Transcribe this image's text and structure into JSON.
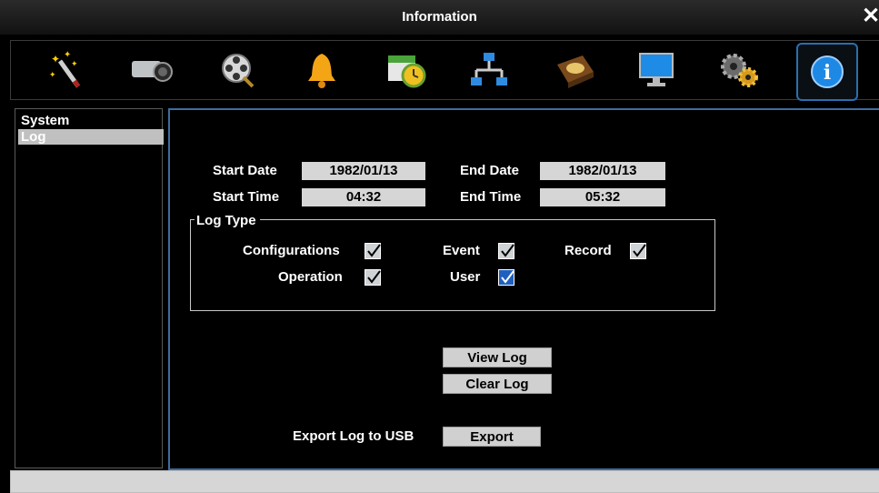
{
  "window": {
    "title": "Information",
    "close_label": "✕"
  },
  "toolbar": {
    "icons": [
      {
        "name": "wizard-icon"
      },
      {
        "name": "camera-icon"
      },
      {
        "name": "film-reel-icon"
      },
      {
        "name": "bell-icon"
      },
      {
        "name": "schedule-clock-icon"
      },
      {
        "name": "network-icon"
      },
      {
        "name": "hard-disk-icon"
      },
      {
        "name": "monitor-icon"
      },
      {
        "name": "gears-icon"
      },
      {
        "name": "info-icon",
        "active": true
      }
    ]
  },
  "sidebar": {
    "items": [
      {
        "label": "System"
      },
      {
        "label": "Log",
        "selected": true
      }
    ]
  },
  "log": {
    "start_date_label": "Start Date",
    "start_date": "1982/01/13",
    "end_date_label": "End Date",
    "end_date": "1982/01/13",
    "start_time_label": "Start Time",
    "start_time": "04:32",
    "end_time_label": "End Time",
    "end_time": "05:32",
    "log_type_label": "Log Type",
    "types": {
      "configurations": {
        "label": "Configurations",
        "checked": true
      },
      "event": {
        "label": "Event",
        "checked": true
      },
      "record": {
        "label": "Record",
        "checked": true
      },
      "operation": {
        "label": "Operation",
        "checked": true
      },
      "user": {
        "label": "User",
        "checked": true,
        "focused": true
      }
    },
    "view_log_label": "View Log",
    "clear_log_label": "Clear Log",
    "export_label": "Export Log to USB",
    "export_button_label": "Export"
  },
  "colors": {
    "accent": "#3f6c9e",
    "field_bg": "#d6d6d6",
    "focus_check": "#1f5fbf"
  }
}
